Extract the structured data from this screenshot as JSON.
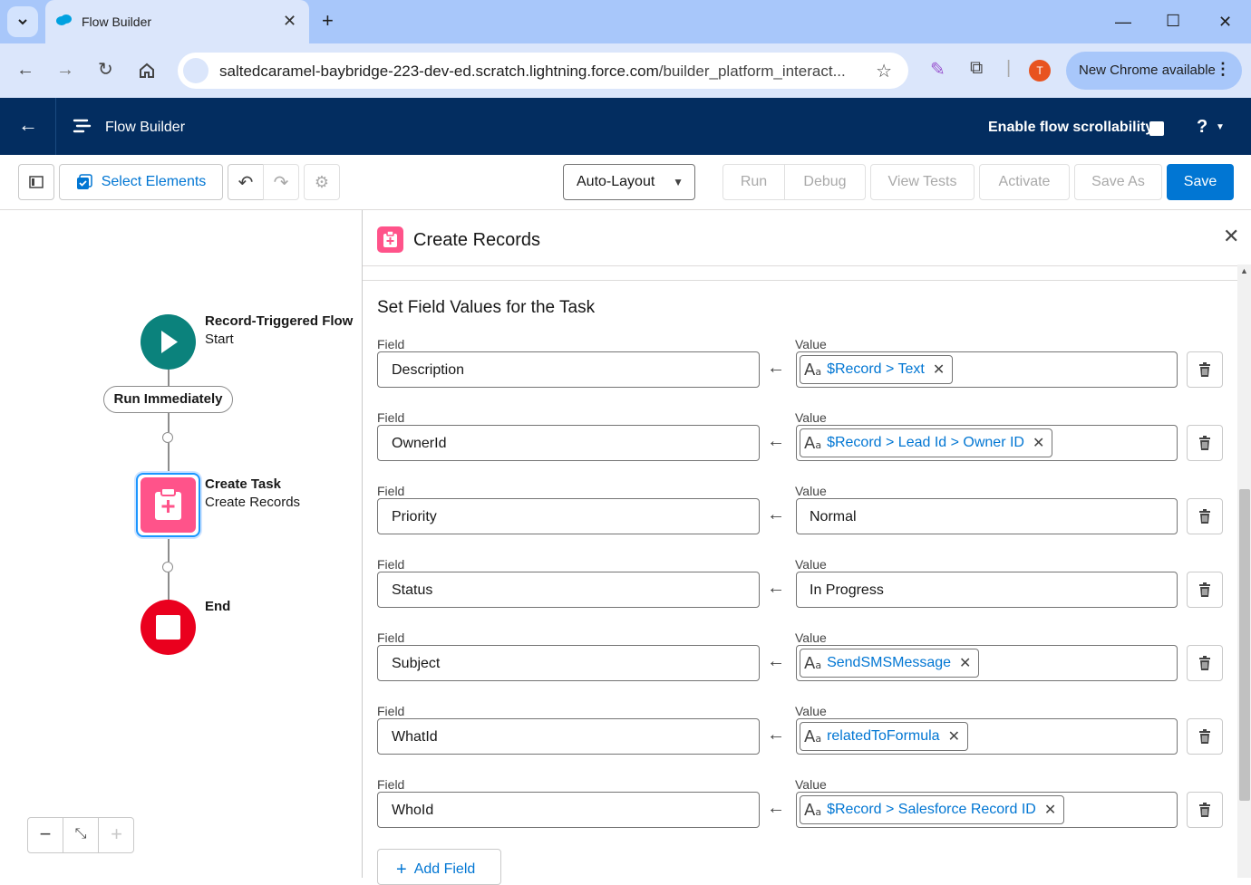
{
  "browser": {
    "tab_title": "Flow Builder",
    "url_host": "saltedcaramel-baybridge-223-dev-ed.scratch.lightning.force.com",
    "url_path": "/builder_platform_interact...",
    "avatar_letter": "T",
    "update_button": "New Chrome available"
  },
  "app": {
    "title": "Flow Builder",
    "scrollability_label": "Enable flow scrollability",
    "help_label": "?"
  },
  "toolbar": {
    "select_elements": "Select Elements",
    "layout_select": "Auto-Layout",
    "run": "Run",
    "debug": "Debug",
    "view_tests": "View Tests",
    "activate": "Activate",
    "save_as": "Save As",
    "save": "Save"
  },
  "canvas": {
    "start_title": "Record-Triggered Flow",
    "start_sub": "Start",
    "schedule_pill": "Run Immediately",
    "task_title": "Create Task",
    "task_sub": "Create Records",
    "end_title": "End"
  },
  "panel": {
    "title": "Create Records",
    "section_title": "Set Field Values for the Task",
    "field_label": "Field",
    "value_label": "Value",
    "add_field": "Add Field",
    "rows": [
      {
        "field": "Description",
        "value": "$Record > Text",
        "is_resource": true
      },
      {
        "field": "OwnerId",
        "value": "$Record > Lead Id > Owner ID",
        "is_resource": true
      },
      {
        "field": "Priority",
        "value": "Normal",
        "is_resource": false
      },
      {
        "field": "Status",
        "value": "In Progress",
        "is_resource": false
      },
      {
        "field": "Subject",
        "value": "SendSMSMessage",
        "is_resource": true
      },
      {
        "field": "WhatId",
        "value": "relatedToFormula",
        "is_resource": true
      },
      {
        "field": "WhoId",
        "value": "$Record > Salesforce Record ID",
        "is_resource": true
      }
    ]
  },
  "colors": {
    "header_bg": "#032d60",
    "brand_blue": "#0176d3",
    "start_node": "#0b827c",
    "task_node": "#ff538a",
    "end_node": "#ea001e"
  }
}
